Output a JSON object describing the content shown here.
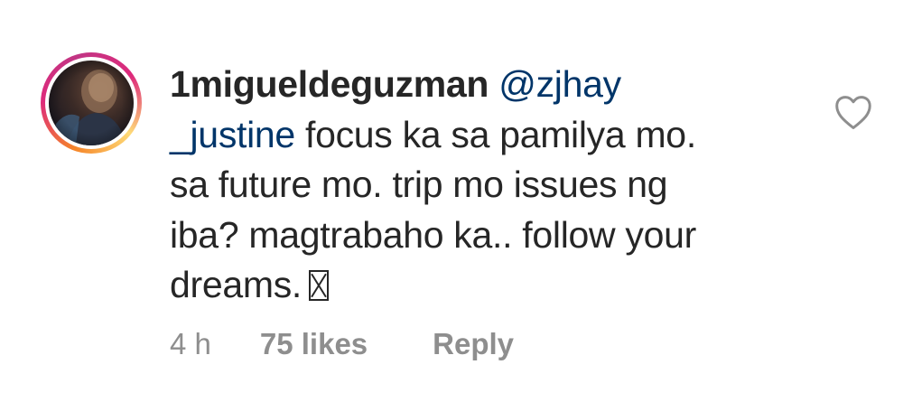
{
  "comment": {
    "username": "1migueldeguzman",
    "mention": "@zjhay_justine",
    "mention_part1": "@zjhay",
    "mention_part2": "_justine",
    "line1_rest": "focus ka sa pamilya mo.",
    "line2": "sa future mo. trip mo issues ng",
    "line3": "iba? magtrabaho ka.. follow your",
    "line4": "dreams.",
    "time": "4 h",
    "likes": "75 likes",
    "reply": "Reply"
  },
  "icons": {
    "avatar": "profile-avatar",
    "like": "heart-outline-icon",
    "emoji": "missing-glyph-emoji-icon"
  },
  "colors": {
    "text": "#262626",
    "mention": "#003569",
    "meta": "#8e8e8e",
    "story_ring": [
      "#f58529",
      "#dd2a7b",
      "#c13584",
      "#feda77"
    ]
  }
}
